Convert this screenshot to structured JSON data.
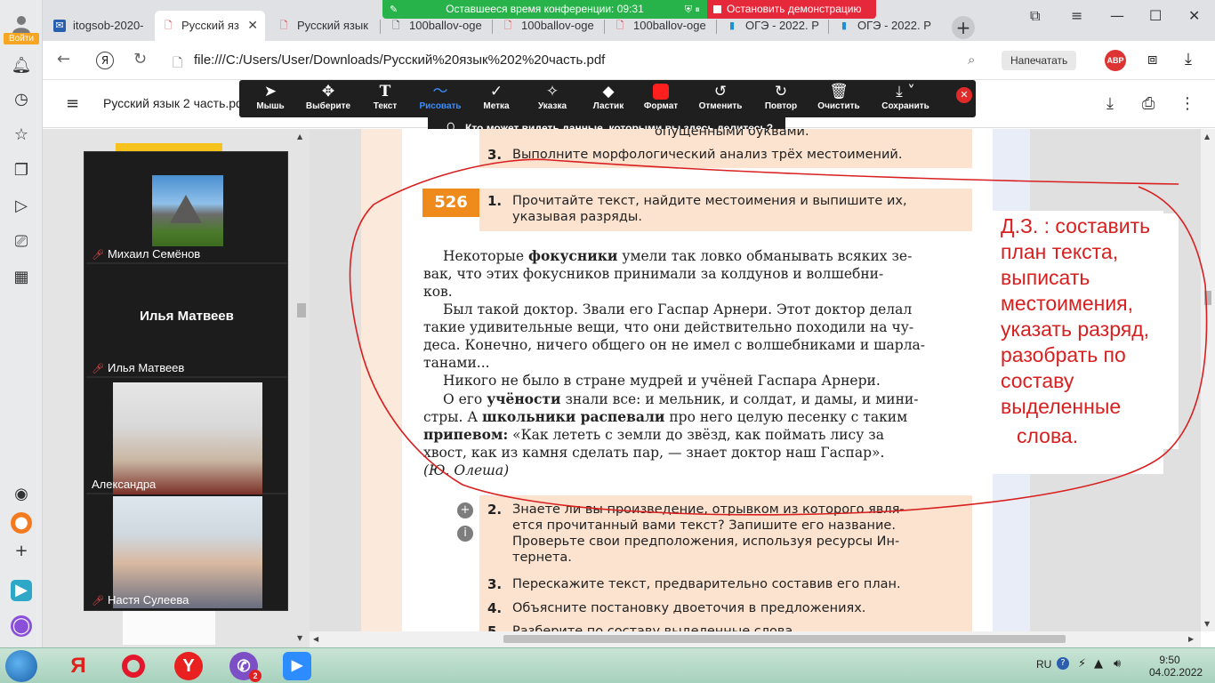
{
  "browser": {
    "login_label": "Войти",
    "tabs": [
      {
        "title": "itogsob-2020-",
        "icon": "mail-icon"
      },
      {
        "title": "Русский яз",
        "icon": "pdf-icon",
        "active": true
      },
      {
        "title": "Русский язык",
        "icon": "pdf-icon"
      },
      {
        "title": "100ballov-oge",
        "icon": "doc-icon"
      },
      {
        "title": "100ballov-oge",
        "icon": "pdf-icon"
      },
      {
        "title": "100ballov-oge",
        "icon": "pdf-icon"
      },
      {
        "title": "ОГЭ - 2022. Р",
        "icon": "book-icon"
      },
      {
        "title": "ОГЭ - 2022. Р",
        "icon": "book-icon"
      }
    ],
    "url": "file:///C:/Users/User/Downloads/Русский%20язык%202%20часть.pdf",
    "print_label": "Напечатать",
    "adblock_label": "АВР"
  },
  "conference": {
    "timer_text": "Оставшееся время конференции: 09:31",
    "stop_label": "Остановить демонстрацию",
    "who_sees": "Кто может видеть данные, которыми вы здесь делитесь?"
  },
  "pdf": {
    "title": "Русский язык 2 часть.pdf"
  },
  "drawbar": {
    "tools": [
      {
        "label": "Мышь",
        "icon": "cursor-icon"
      },
      {
        "label": "Выберите",
        "icon": "move-icon"
      },
      {
        "label": "Текст",
        "icon": "text-icon"
      },
      {
        "label": "Рисовать",
        "icon": "draw-icon",
        "active": true
      },
      {
        "label": "Метка",
        "icon": "stamp-icon"
      },
      {
        "label": "Указка",
        "icon": "spotlight-icon"
      },
      {
        "label": "Ластик",
        "icon": "eraser-icon"
      },
      {
        "label": "Формат",
        "icon": "format-icon"
      },
      {
        "label": "Отменить",
        "icon": "undo-icon"
      },
      {
        "label": "Повтор",
        "icon": "redo-icon"
      },
      {
        "label": "Очистить",
        "icon": "trash-icon"
      },
      {
        "label": "Сохранить",
        "icon": "save-icon"
      }
    ],
    "format_color": "#ff1f1f"
  },
  "participants": [
    {
      "name": "Михаил Семёнов",
      "muted": true,
      "kind": "photo"
    },
    {
      "name": "Илья Матвеев",
      "muted": true,
      "kind": "initials",
      "big_name": "Илья Матвеев"
    },
    {
      "name": "Александра",
      "muted": false,
      "kind": "video"
    },
    {
      "name": "Настя Сулеева",
      "muted": true,
      "kind": "video"
    }
  ],
  "page": {
    "top_fragment": "опущенными буквами.",
    "q3_prev_num": "3.",
    "q3_prev": "Выполните морфологический анализ трёх местоимений.",
    "exercise_num": "526",
    "task1_num": "1.",
    "task1_line1": "Прочитайте текст, найдите местоимения и выпишите их,",
    "task1_line2": "указывая разряды.",
    "para1_pre": "Некоторые ",
    "para1_bold": "фокусники",
    "para1_l1_post": " умели так ловко обманывать всяких зе-",
    "para1_l2": "вак, что этих фокусников принимали за колдунов и волшебни-",
    "para1_l3": "ков.",
    "para2_l1": "Был такой доктор. Звали его Гаспар Арнери. Этот доктор делал",
    "para2_l2": "такие удивительные вещи, что они действительно походили на чу-",
    "para2_l3": "деса. Конечно, ничего общего он не имел с волшебниками и шарла-",
    "para2_l4": "танами...",
    "para3": "Никого не было в стране мудрей и учёней Гаспара Арнери.",
    "para4_l1_pre": "О его ",
    "para4_l1_bold": "учёности",
    "para4_l1_post": " знали все: и мельник, и солдат, и дамы, и мини-",
    "para4_l2_pre": "стры. А ",
    "para4_l2_bold": "школьники распевали",
    "para4_l2_post": " про него целую песенку с таким",
    "para4_l3_bold": "припевом:",
    "para4_l3_post": " «Как лететь с земли до звёзд, как поймать лису за",
    "para4_l4": "хвост, как из камня сделать пар, — знает доктор наш Гаспар».",
    "author": "(Ю. Олеша)",
    "task2_num": "2.",
    "task2_l1": "Знаете ли вы произведение, отрывком из которого явля-",
    "task2_l2": "ется прочитанный вами текст? Запишите его название.",
    "task2_l3": "Проверьте свои предположения, используя ресурсы Ин-",
    "task2_l4": "тернета.",
    "task3_num": "3.",
    "task3": "Перескажите текст, предварительно составив его план.",
    "task4_num": "4.",
    "task4": "Объясните постановку двоеточия в предложениях.",
    "task5_num": "5.",
    "task5": "Разберите по составу выделенные слова."
  },
  "homework_note": [
    "Д.З. : составить",
    "план текста,",
    "выписать",
    "местоимения,",
    "указать разряд,",
    "разобрать по",
    "составу",
    "выделенные",
    "слова."
  ],
  "annotation_color": "#d82020",
  "taskbar": {
    "lang": "RU",
    "time": "9:50",
    "date": "04.02.2022",
    "viber_badge": "2"
  }
}
